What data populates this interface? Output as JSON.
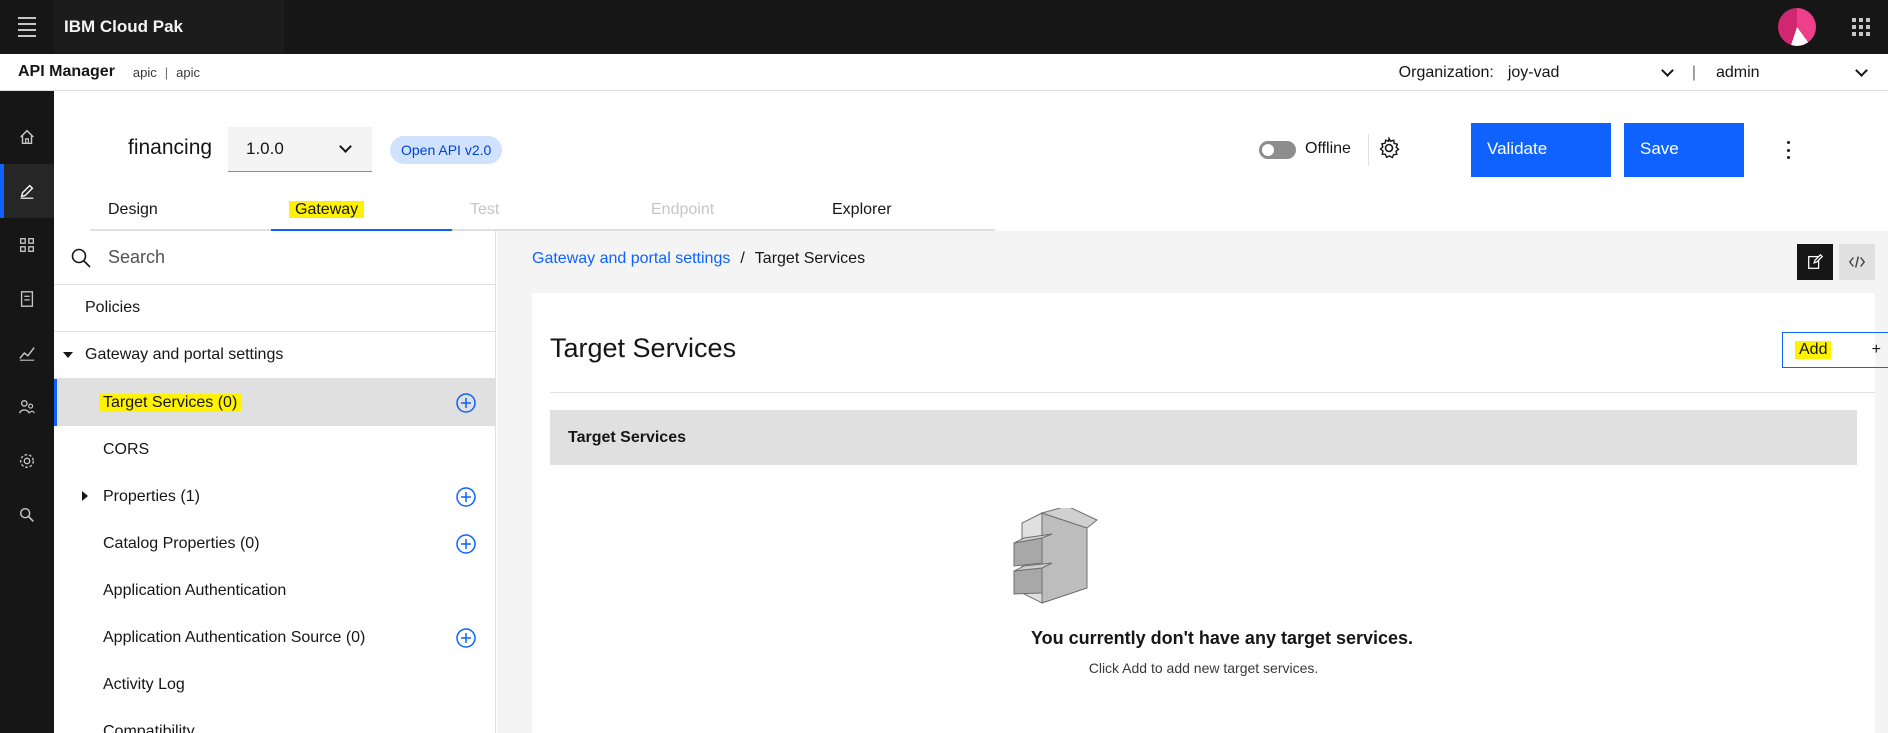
{
  "topbar": {
    "brand": "IBM Cloud Pak"
  },
  "subheader": {
    "app_name": "API Manager",
    "crumb_1": "apic",
    "crumb_sep": "|",
    "crumb_2": "apic",
    "org_label": "Organization:",
    "org_value": "joy-vad",
    "pipe": "|",
    "user_value": "admin"
  },
  "rail": {
    "items": [
      "home-icon",
      "edit-icon",
      "apps-icon",
      "catalog-icon",
      "analytics-icon",
      "members-icon",
      "settings-icon",
      "search-icon"
    ],
    "active": "edit-icon"
  },
  "api": {
    "title": "financing",
    "version": "1.0.0",
    "spec_tag": "Open API v2.0",
    "offline_label": "Offline",
    "validate_label": "Validate",
    "save_label": "Save"
  },
  "tabs": [
    {
      "label": "Design"
    },
    {
      "label": "Gateway"
    },
    {
      "label": "Test"
    },
    {
      "label": "Endpoint"
    },
    {
      "label": "Explorer"
    }
  ],
  "sidebar": {
    "search_placeholder": "Search",
    "items": [
      {
        "label": "Policies"
      },
      {
        "label": "Gateway and portal settings"
      },
      {
        "label": "Target Services (0)"
      },
      {
        "label": "CORS"
      },
      {
        "label": "Properties (1)"
      },
      {
        "label": "Catalog Properties (0)"
      },
      {
        "label": "Application Authentication"
      },
      {
        "label": "Application Authentication Source (0)"
      },
      {
        "label": "Activity Log"
      },
      {
        "label": "Compatibility"
      }
    ]
  },
  "main": {
    "breadcrumb_link": "Gateway and portal settings",
    "breadcrumb_sep": "/",
    "breadcrumb_current": "Target Services",
    "card_title": "Target Services",
    "add_label": "Add",
    "add_plus": "+",
    "table_header": "Target Services",
    "empty_title": "You currently don't have any target services.",
    "empty_sub": "Click Add to add new target services."
  },
  "colors": {
    "accent": "#0f62fe",
    "highlight": "#fff200",
    "topbar": "#161616",
    "tag_bg": "#d0e2ff"
  }
}
